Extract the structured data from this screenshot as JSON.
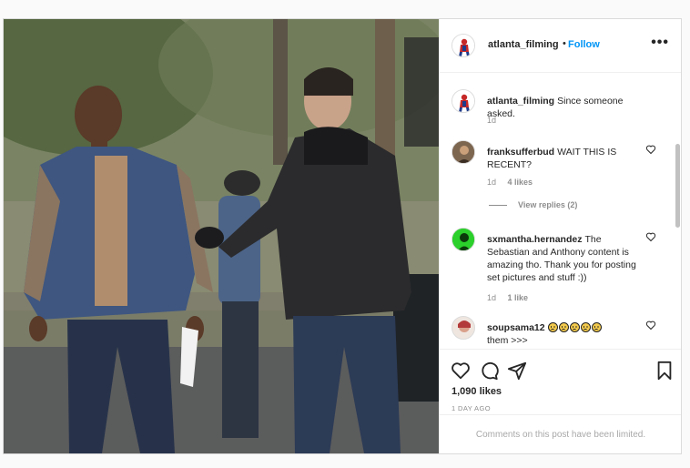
{
  "post": {
    "author": {
      "username": "atlanta_filming",
      "separator": "•",
      "follow_label": "Follow",
      "more_icon": "more-options-icon",
      "more_glyph": "•••"
    },
    "caption": {
      "username": "atlanta_filming",
      "text": "Since someone asked.",
      "time": "1d"
    },
    "comments": [
      {
        "username": "franksufferbud",
        "text": "WAIT THIS IS RECENT?",
        "time": "1d",
        "likes": "4 likes",
        "view_replies": "View replies (2)"
      },
      {
        "username": "sxmantha.hernandez",
        "text": "The Sebastian and Anthony content is amazing tho. Thank you for posting set pictures and stuff :))",
        "time": "1d",
        "likes": "1 like"
      },
      {
        "username": "soupsama12",
        "text": "them >>>",
        "emoji_icon": "frowning-face-emoji",
        "emoji_count": 5
      }
    ],
    "likes": "1,090 likes",
    "time_ago": "1 DAY AGO",
    "comments_limited": "Comments on this post have been limited."
  },
  "colors": {
    "accent_blue": "#0095f6",
    "text": "#262626",
    "muted": "#8e8e8e",
    "border": "#dbdbdb"
  }
}
